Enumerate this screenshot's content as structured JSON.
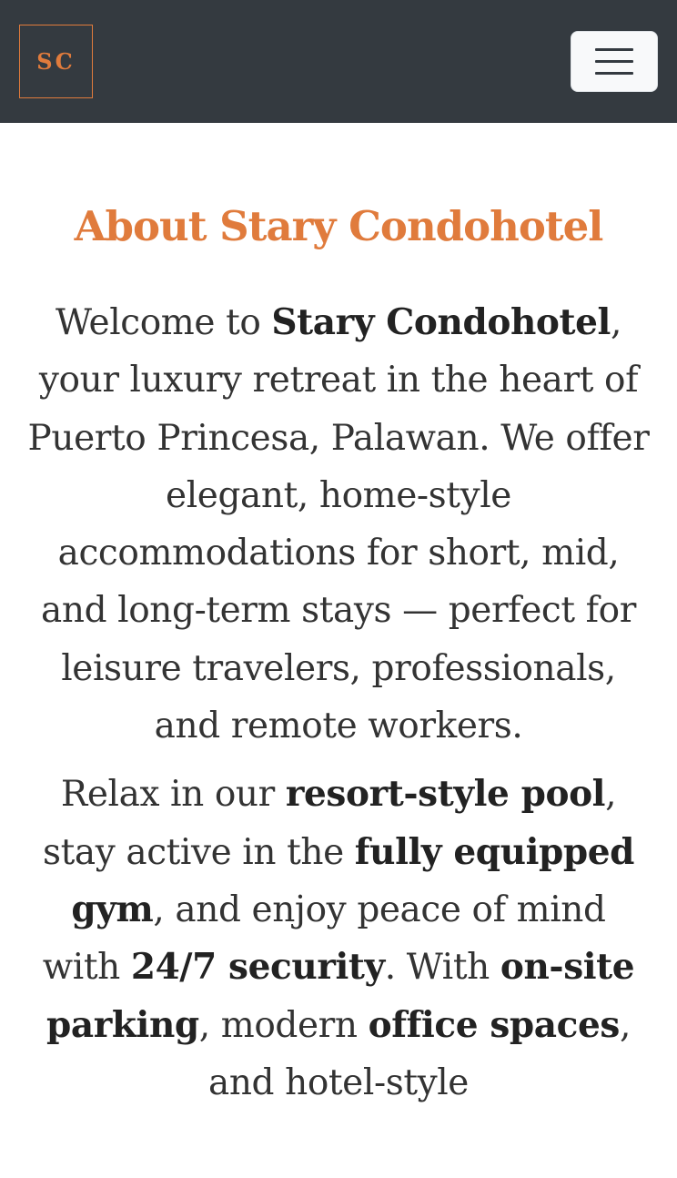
{
  "navbar": {
    "logo_text": "SC",
    "menu_toggle": "menu-toggle",
    "colors": {
      "background": "#343a40",
      "accent": "#e07b3c"
    }
  },
  "about": {
    "title": "About Stary Condohotel",
    "p1": {
      "t1": "Welcome to ",
      "b1": "Stary Condohotel",
      "t2": ", your luxury retreat in the heart of Puerto Princesa, Palawan. We offer elegant, home-style accommodations for short, mid, and long-term stays — perfect for leisure travelers, professionals, and remote workers."
    },
    "p2": {
      "t1": "Relax in our ",
      "b1": "resort-style pool",
      "t2": ", stay active in the ",
      "b2": "fully equipped gym",
      "t3": ", and enjoy peace of mind with ",
      "b3": "24/7 security",
      "t4": ". With ",
      "b4": "on-site parking",
      "t5": ", modern ",
      "b5": "office spaces",
      "t6": ", and hotel-style"
    }
  }
}
